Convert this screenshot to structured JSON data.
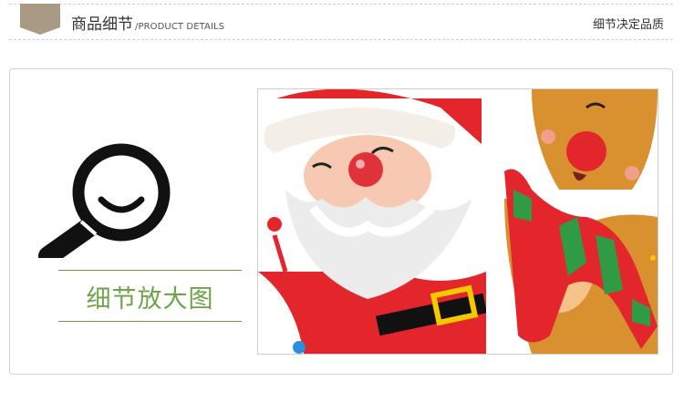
{
  "header": {
    "title": "商品细节",
    "subtitle": "/PRODUCT DETAILS",
    "right_text": "细节决定品质",
    "tag_color": "#a89a83"
  },
  "panel": {
    "label": "细节放大图",
    "accent_color": "#6ea448",
    "icon": "magnifier-icon"
  },
  "image": {
    "description_icons": [
      "santa-claus-illustration",
      "reindeer-illustration"
    ]
  }
}
